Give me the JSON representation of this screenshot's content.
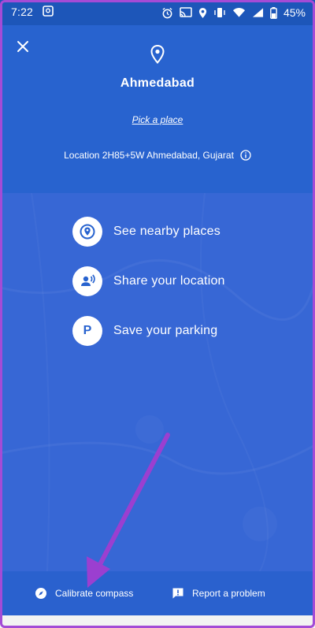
{
  "status_bar": {
    "time": "7:22",
    "battery": "45%"
  },
  "header": {
    "place_name": "Ahmedabad",
    "pick_place": "Pick a place",
    "location_text": "Location 2H85+5W Ahmedabad, Gujarat"
  },
  "actions": [
    {
      "label": "See nearby places",
      "icon": "location-target-icon"
    },
    {
      "label": "Share your location",
      "icon": "share-location-person-icon"
    },
    {
      "label": "Save your parking",
      "icon": "parking-icon",
      "glyph": "P"
    }
  ],
  "bottom_bar": {
    "calibrate_label": "Calibrate compass",
    "report_label": "Report a problem"
  },
  "colors": {
    "status_bar": "#1d56b9",
    "header": "#2863cf",
    "map_overlay": "#3767d5",
    "bottom_bar": "#2a61ce",
    "annotation_arrow": "#9b3fd0"
  }
}
